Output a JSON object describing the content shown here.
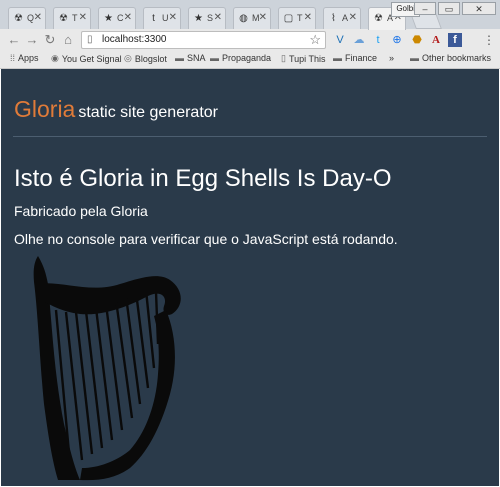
{
  "browser": {
    "tabs": [
      {
        "icon": "radioactive-icon",
        "glyph": "☢",
        "label": "Q"
      },
      {
        "icon": "radioactive-icon",
        "glyph": "☢",
        "label": "T"
      },
      {
        "icon": "bookmark-star-icon",
        "glyph": "★",
        "label": "C"
      },
      {
        "icon": "twitter-icon",
        "glyph": "t",
        "label": "U"
      },
      {
        "icon": "bookmark-star-icon",
        "glyph": "★",
        "label": "S"
      },
      {
        "icon": "globe-icon",
        "glyph": "◍",
        "label": "M"
      },
      {
        "icon": "page-icon",
        "glyph": "▢",
        "label": "T"
      },
      {
        "icon": "harp-icon",
        "glyph": "⌇",
        "label": "A"
      },
      {
        "icon": "radioactive-icon",
        "glyph": "☢",
        "label": "A"
      }
    ],
    "user_badge": "Golbi",
    "url": "localhost:3300",
    "bookmarks": [
      {
        "icon": "apps-icon",
        "glyph": "⁞⁞",
        "label": "Apps"
      },
      {
        "icon": "signal-icon",
        "glyph": "◉",
        "label": "You Get Signal"
      },
      {
        "icon": "blog-icon",
        "glyph": "◎",
        "label": "Blogslot"
      },
      {
        "icon": "folder-icon",
        "glyph": "▬",
        "label": "SNA"
      },
      {
        "icon": "folder-icon",
        "glyph": "▬",
        "label": "Propaganda"
      },
      {
        "icon": "page-icon",
        "glyph": "▯",
        "label": "Tupi This"
      },
      {
        "icon": "folder-icon",
        "glyph": "▬",
        "label": "Finance"
      }
    ],
    "overflow": "»",
    "other_bookmarks": "Other bookmarks"
  },
  "site": {
    "name": "Gloria",
    "tagline": "static site generator"
  },
  "content": {
    "heading": "Isto é Gloria in Egg Shells Is Day-O",
    "subtitle": "Fabricado pela Gloria",
    "paragraph": "Olhe no console para verificar que o JavaScript está rodando."
  },
  "colors": {
    "page_bg": "#2a3a4a",
    "accent": "#e07b39",
    "text": "#ffffff",
    "harp": "#0a0a0a"
  }
}
